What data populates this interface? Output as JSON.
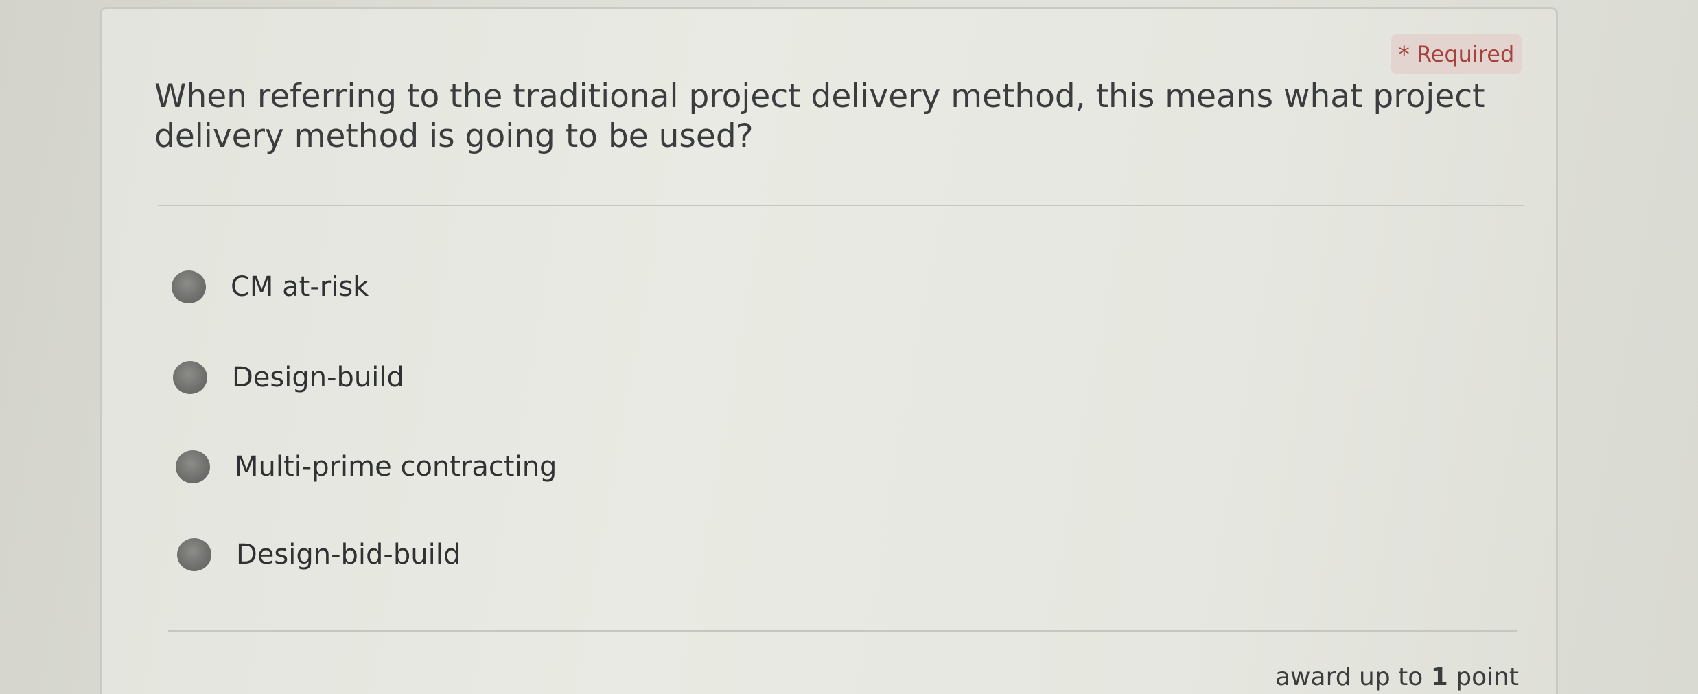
{
  "question": {
    "required_label": "* Required",
    "text": "When referring to the traditional project delivery method, this means what project delivery method is going to be used?",
    "options": [
      {
        "label": "CM at-risk"
      },
      {
        "label": "Design-build"
      },
      {
        "label": "Multi-prime contracting"
      },
      {
        "label": "Design-bid-build"
      }
    ]
  },
  "footer": {
    "prefix": "award up to ",
    "points": "1",
    "suffix": " point"
  }
}
